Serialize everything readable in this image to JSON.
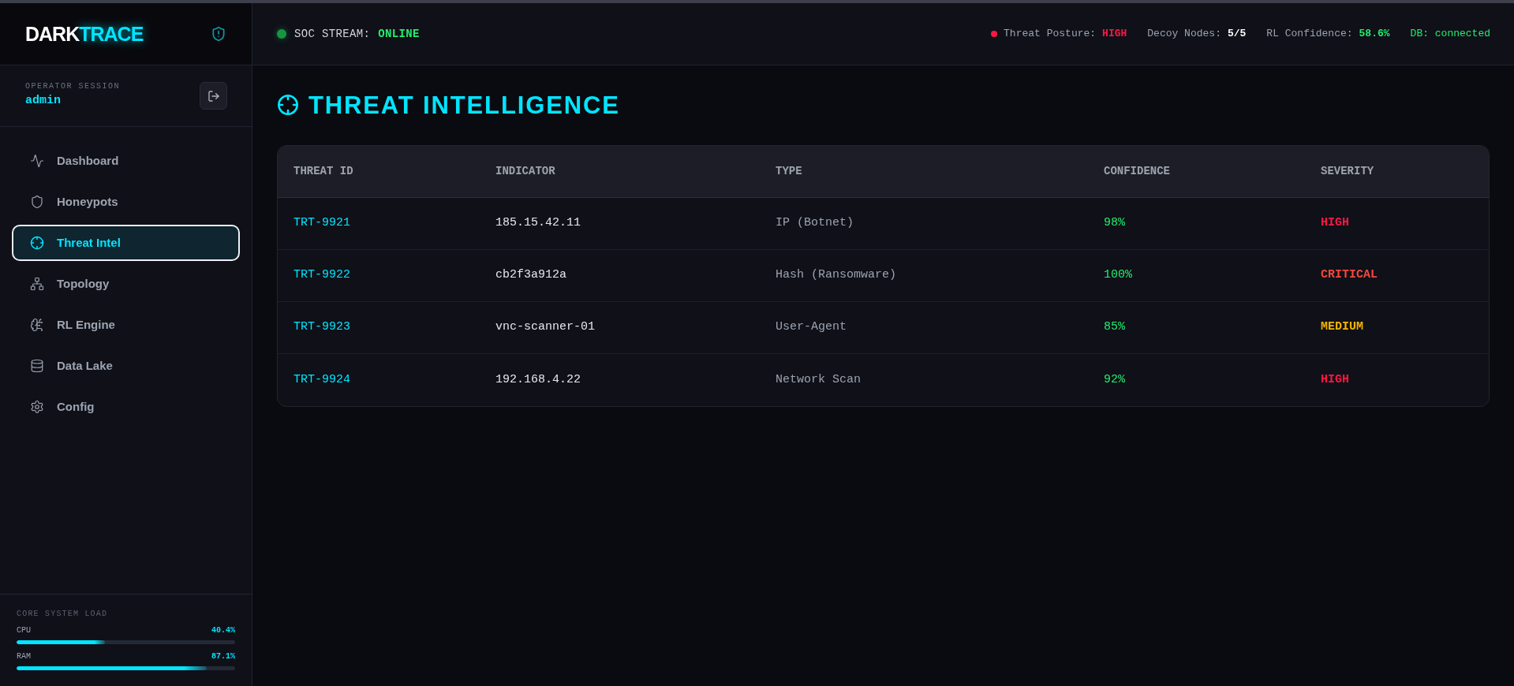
{
  "logo": {
    "text": "DARK",
    "accent": "TRACE"
  },
  "session": {
    "label": "OPERATOR SESSION",
    "user": "admin"
  },
  "nav": {
    "items": [
      {
        "label": "Dashboard",
        "selected": false
      },
      {
        "label": "Honeypots",
        "selected": false
      },
      {
        "label": "Threat Intel",
        "selected": true
      },
      {
        "label": "Topology",
        "selected": false
      },
      {
        "label": "RL Engine",
        "selected": false
      },
      {
        "label": "Data Lake",
        "selected": false
      },
      {
        "label": "Config",
        "selected": false
      }
    ]
  },
  "system_load": {
    "title": "CORE SYSTEM LOAD",
    "meters": [
      {
        "name": "CPU",
        "reading": "40.4%",
        "level": 0.404
      },
      {
        "name": "RAM",
        "reading": "87.1%",
        "level": 0.871
      }
    ]
  },
  "top_bar": {
    "stream": {
      "label": "SOC STREAM:",
      "value": "ONLINE",
      "online": true
    },
    "stats": [
      {
        "kind": "alert",
        "label": "Threat Posture:",
        "value": "HIGH",
        "color": "#ff1744"
      },
      {
        "kind": "metric",
        "label": "Decoy Nodes:",
        "value": "5/5",
        "color": "#ffffff"
      },
      {
        "kind": "metric",
        "label": "RL Confidence:",
        "value": "58.6%",
        "color": "#22ee6e"
      },
      {
        "kind": "status",
        "label": "DB:",
        "value": "connected",
        "color": "#22ee6e"
      }
    ]
  },
  "page": {
    "title": "THREAT INTELLIGENCE"
  },
  "table": {
    "columns": [
      "THREAT ID",
      "INDICATOR",
      "TYPE",
      "CONFIDENCE",
      "SEVERITY"
    ],
    "rows": [
      {
        "threat_id": "TRT-9921",
        "indicator": "185.15.42.11",
        "type": "IP (Botnet)",
        "confidence": "98%",
        "severity": "HIGH",
        "color": "#ff1744"
      },
      {
        "threat_id": "TRT-9922",
        "indicator": "cb2f3a912a",
        "type": "Hash (Ransomware)",
        "confidence": "100%",
        "severity": "CRITICAL",
        "color": "#f4473e"
      },
      {
        "threat_id": "TRT-9923",
        "indicator": "vnc-scanner-01",
        "type": "User-Agent",
        "confidence": "85%",
        "severity": "MEDIUM",
        "color": "#f8b400"
      },
      {
        "threat_id": "TRT-9924",
        "indicator": "192.168.4.22",
        "type": "Network Scan",
        "confidence": "92%",
        "severity": "HIGH",
        "color": "#ff1744"
      }
    ]
  }
}
